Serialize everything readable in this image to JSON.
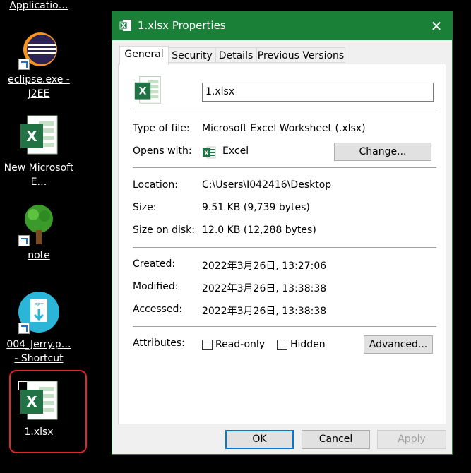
{
  "desktop": {
    "items": [
      {
        "label": "Applicatio…"
      },
      {
        "label": "eclipse.exe - J2EE"
      },
      {
        "label": "New Microsoft E…"
      },
      {
        "label": "note"
      },
      {
        "label": "004_Jerry.p… - Shortcut"
      },
      {
        "label": "1.xlsx"
      }
    ],
    "ppt_badge": "PPT"
  },
  "dialog": {
    "title": "1.xlsx Properties",
    "close_glyph": "✕",
    "tabs": [
      "General",
      "Security",
      "Details",
      "Previous Versions"
    ],
    "filename": "1.xlsx",
    "type_label": "Type of file:",
    "type_value": "Microsoft Excel Worksheet (.xlsx)",
    "opens_label": "Opens with:",
    "opens_value": "Excel",
    "change_button": "Change...",
    "location_label": "Location:",
    "location_value": "C:\\Users\\I042416\\Desktop",
    "size_label": "Size:",
    "size_value": "9.51 KB (9,739 bytes)",
    "disk_label": "Size on disk:",
    "disk_value": "12.0 KB (12,288 bytes)",
    "created_label": "Created:",
    "created_value": "2022年3月26日, 13:27:06",
    "modified_label": "Modified:",
    "modified_value": "2022年3月26日, 13:38:38",
    "accessed_label": "Accessed:",
    "accessed_value": "2022年3月26日, 13:38:38",
    "attributes_label": "Attributes:",
    "readonly_label": "Read-only",
    "hidden_label": "Hidden",
    "advanced_button": "Advanced...",
    "ok_button": "OK",
    "cancel_button": "Cancel",
    "apply_button": "Apply"
  },
  "colors": {
    "titlebar": "#1a7f37",
    "excel_green": "#217346",
    "selection_border": "#e0252b",
    "accent_blue": "#0078d7"
  }
}
